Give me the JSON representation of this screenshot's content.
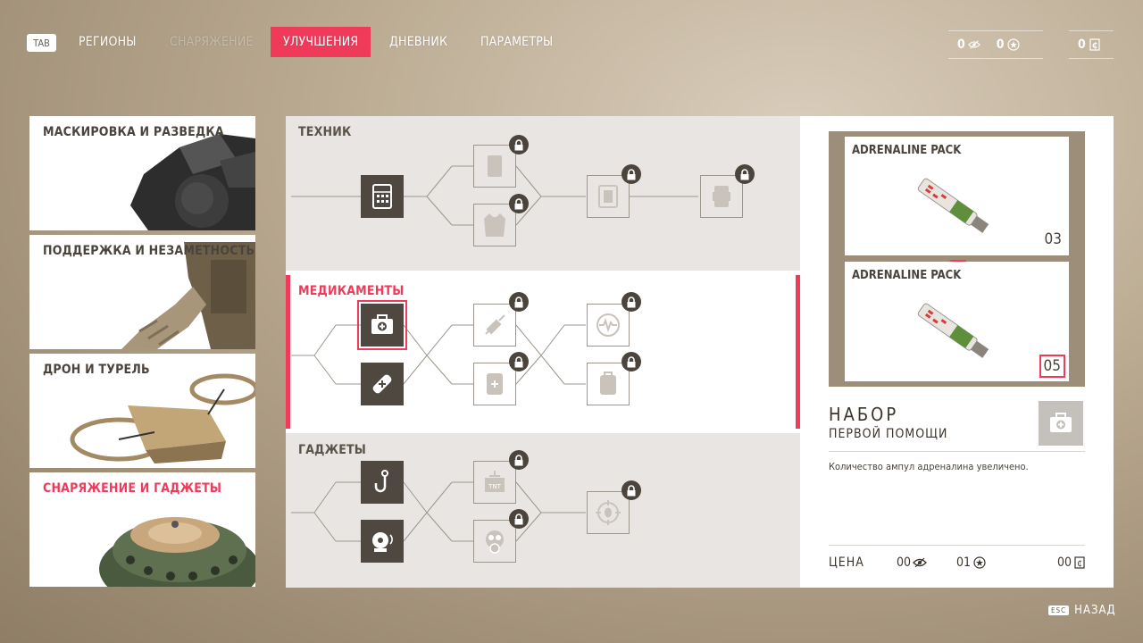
{
  "nav": {
    "tab_key": "TAB",
    "items": [
      "РЕГИОНЫ",
      "СНАРЯЖЕНИЕ",
      "УЛУЧШЕНИЯ",
      "ДНЕВНИК",
      "ПАРАМЕТРЫ"
    ],
    "active_index": 2
  },
  "currency": {
    "eye": "0",
    "star": "0",
    "credits": "0"
  },
  "categories": [
    {
      "label": "МАСКИРОВКА И РАЗВЕДКА"
    },
    {
      "label": "ПОДДЕРЖКА И НЕЗАМЕТНОСТЬ"
    },
    {
      "label": "ДРОН И ТУРЕЛЬ"
    },
    {
      "label": "СНАРЯЖЕНИЕ И ГАДЖЕТЫ"
    }
  ],
  "sections": {
    "technician": "ТЕХНИК",
    "medkits": "МЕДИКАМЕНТЫ",
    "gadgets": "ГАДЖЕТЫ"
  },
  "detail": {
    "cards": [
      {
        "name": "ADRENALINE PACK",
        "count": "03"
      },
      {
        "name": "ADRENALINE PACK",
        "count": "05"
      }
    ],
    "title": "НАБОР",
    "subtitle": "ПЕРВОЙ ПОМОЩИ",
    "description": "Количество ампул адреналина увеличено.",
    "price_label": "ЦЕНА",
    "price_eye": "00",
    "price_star": "01",
    "price_credits": "00"
  },
  "footer": {
    "esc_key": "ESC",
    "back": "НАЗАД"
  },
  "colors": {
    "accent": "#f03a5a",
    "dark_node": "#4f4840"
  }
}
